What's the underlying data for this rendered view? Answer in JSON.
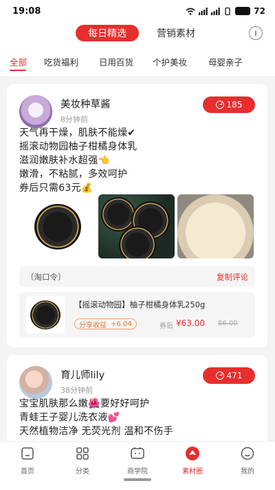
{
  "status_bar": {
    "time": "19:08",
    "battery": "72"
  },
  "header": {
    "tabs": [
      {
        "label": "每日精选",
        "active": true
      },
      {
        "label": "营销素材",
        "active": false
      }
    ],
    "info_icon": "i"
  },
  "categories": [
    {
      "label": "全部",
      "active": true
    },
    {
      "label": "吃货福利",
      "active": false
    },
    {
      "label": "日用百货",
      "active": false
    },
    {
      "label": "个护美妆",
      "active": false
    },
    {
      "label": "母婴亲子",
      "active": false
    }
  ],
  "posts": [
    {
      "author": "美妆种草酱",
      "time": "8分钟前",
      "share_count": "185",
      "lines": [
        "天气再干燥，肌肤不能燥✔",
        "摇滚动物园柚子柑橘身体乳",
        "滋润嫩肤补水超强👈",
        "嫩滑，不粘腻，多效呵护",
        "券后只需63元💰"
      ],
      "images": [
        "product-jar-image",
        "product-jars-image",
        "body-cream-texture-image"
      ],
      "taobao_label": "〔淘口令〕",
      "copy_label": "复制评论",
      "product": {
        "title": "【摇滚动物园】柚子柑橘身体乳250g",
        "earn_label": "分享收益",
        "earn_amount": "+6.04",
        "after_coupon_label": "券后",
        "price": "¥63.00",
        "original_price": "86.00"
      }
    },
    {
      "author": "育儿师lily",
      "time": "38分钟前",
      "share_count": "471",
      "lines": [
        "宝宝肌肤那么嫩🌺要好好呵护",
        "青蛙王子婴儿洗衣液💕",
        "天然植物洁净 无荧光剂 温和不伤手"
      ]
    }
  ],
  "bottom_nav": [
    {
      "label": "首页",
      "icon": "home-icon",
      "active": false
    },
    {
      "label": "分类",
      "icon": "grid-icon",
      "active": false
    },
    {
      "label": "商学院",
      "icon": "academy-icon",
      "active": false
    },
    {
      "label": "素材圈",
      "icon": "material-icon",
      "active": true
    },
    {
      "label": "我的",
      "icon": "profile-icon",
      "active": false
    }
  ],
  "colors": {
    "accent": "#e62e2e",
    "earn": "#e87a2e",
    "background": "#f4f4f4"
  }
}
